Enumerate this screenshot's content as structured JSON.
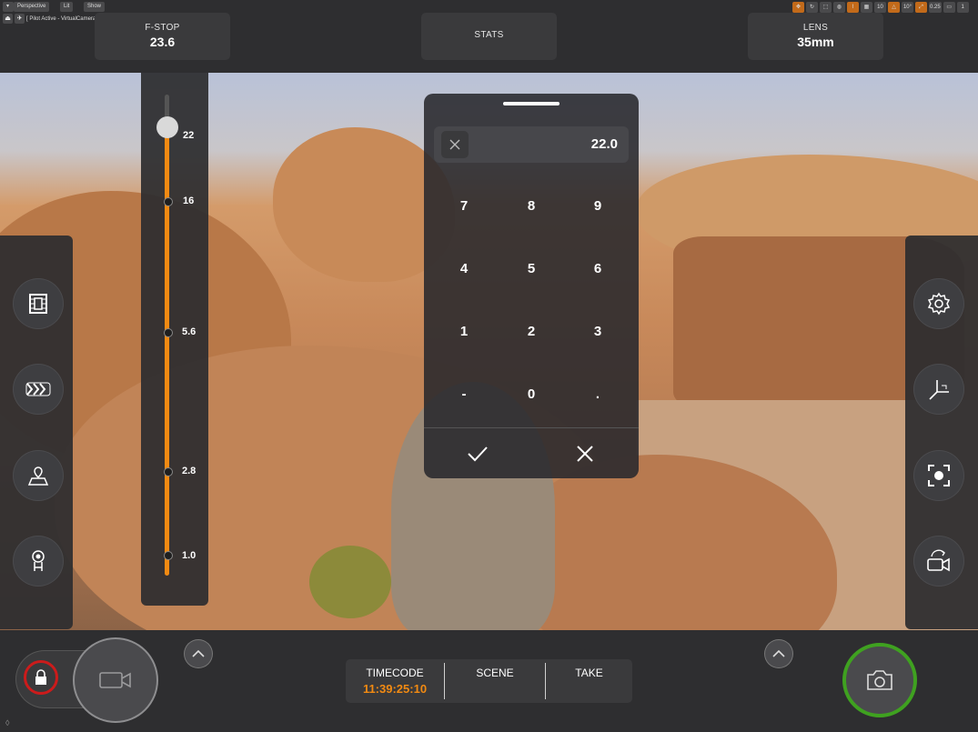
{
  "viewport": {
    "buttons": [
      "Perspective",
      "Lit",
      "Show"
    ],
    "pilot_label": "[ Pilot Active - VirtualCamera2Actor ]",
    "right_values": [
      "10",
      "10°",
      "0.25",
      "1"
    ],
    "footer_glyph": "◊"
  },
  "header": {
    "fstop_label": "F-STOP",
    "fstop_value": "23.6",
    "stats_label": "STATS",
    "lens_label": "LENS",
    "lens_value": "35mm"
  },
  "fstop_slider": {
    "ticks": [
      "22",
      "16",
      "5.6",
      "2.8",
      "1.0"
    ],
    "level": 1.0,
    "accent": "#f28a12"
  },
  "keypad": {
    "display_value": "22.0",
    "keys": [
      "7",
      "8",
      "9",
      "4",
      "5",
      "6",
      "1",
      "2",
      "3",
      "-",
      "0",
      "."
    ],
    "confirm_icon": "check-icon",
    "cancel_icon": "close-icon"
  },
  "left_tools": [
    "film-strip-icon",
    "chevrons-icon",
    "location-pin-icon",
    "tracking-icon"
  ],
  "right_tools": [
    "settings-gear-icon",
    "axis-gizmo-icon",
    "focus-target-icon",
    "camera-switch-icon"
  ],
  "bottom": {
    "timecode_label": "TIMECODE",
    "timecode_value": "11:39:25:10",
    "scene_label": "SCENE",
    "take_label": "TAKE",
    "accent": "#f28a12",
    "record_ring": "#3fa120",
    "lock_ring": "#cc1b1b"
  }
}
